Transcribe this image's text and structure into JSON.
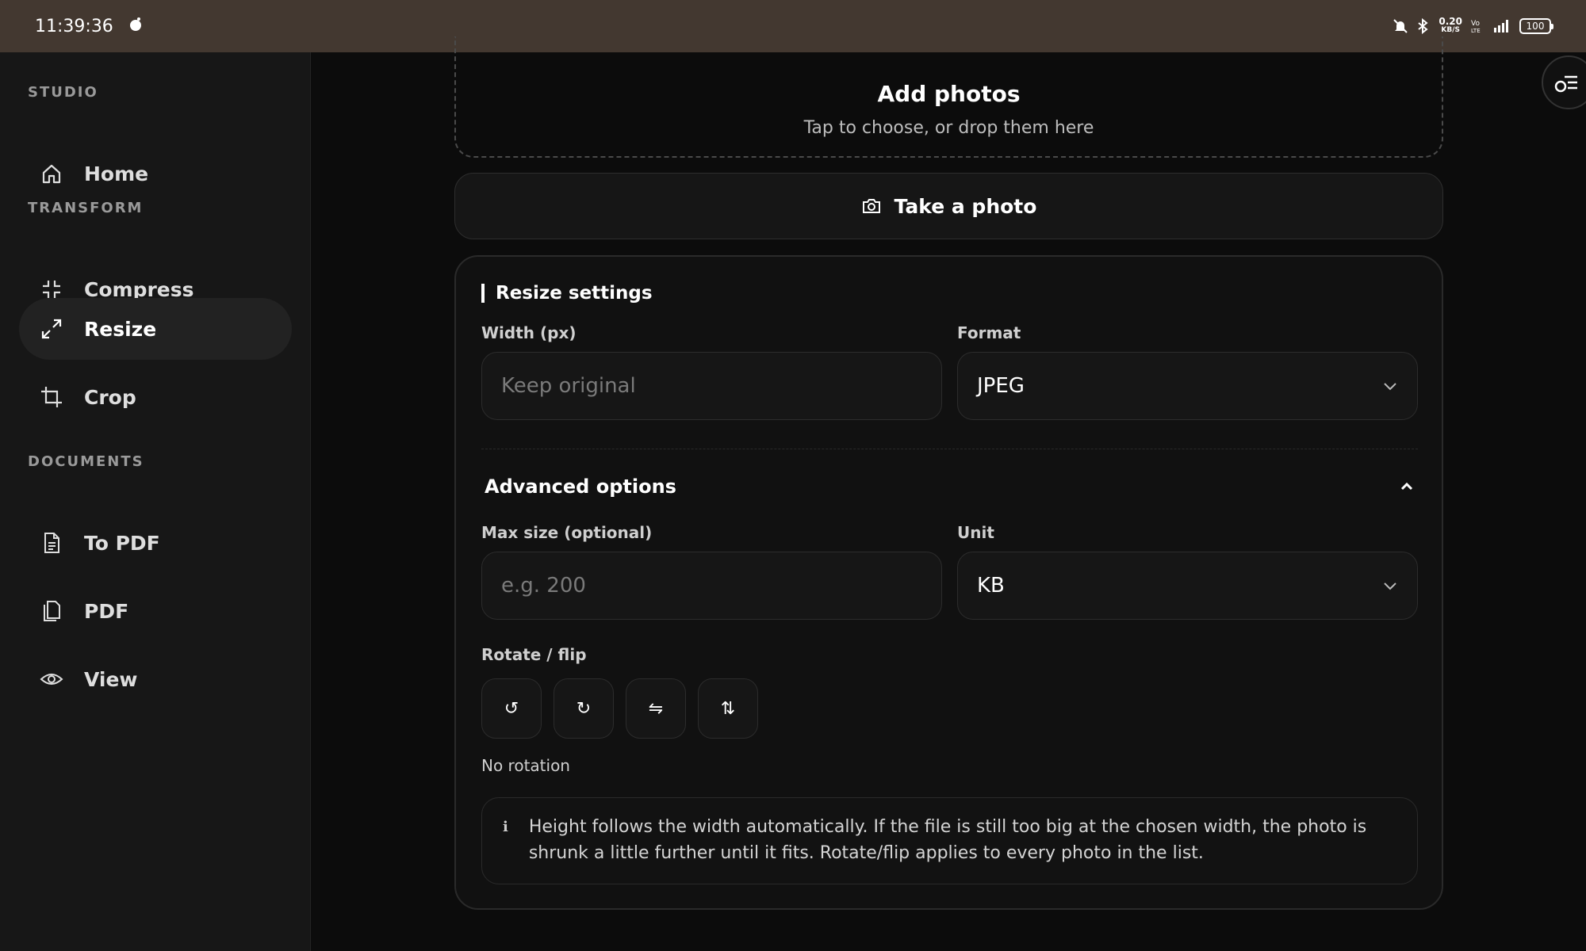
{
  "status_bar": {
    "time": "11:39:36",
    "net_speed_value": "0.20",
    "net_speed_unit": "KB/S",
    "battery": "100"
  },
  "sidebar": {
    "sections": {
      "studio": "STUDIO",
      "transform": "TRANSFORM",
      "documents": "DOCUMENTS"
    },
    "items": {
      "home": "Home",
      "compress": "Compress",
      "resize": "Resize",
      "crop": "Crop",
      "to_pdf": "To PDF",
      "pdf": "PDF",
      "view": "View"
    },
    "active": "Resize"
  },
  "upload": {
    "title": "Add photos",
    "subtitle": "Tap to choose, or drop them here",
    "take_photo": "Take a photo"
  },
  "settings": {
    "title": "Resize settings",
    "width_label": "Width (px)",
    "width_placeholder": "Keep original",
    "format_label": "Format",
    "format_value": "JPEG",
    "advanced_label": "Advanced options",
    "max_size_label": "Max size (optional)",
    "max_size_placeholder": "e.g. 200",
    "unit_label": "Unit",
    "unit_value": "KB",
    "rotate_label": "Rotate / flip",
    "rotation_status": "No rotation",
    "info_icon": "i",
    "info_text": "Height follows the width automatically. If the file is still too big at the chosen width, the photo is shrunk a little further until it fits. Rotate/flip applies to every photo in the list."
  },
  "icons": {
    "rotate_left": "↺",
    "rotate_right": "↻",
    "flip_horizontal": "⇋",
    "flip_vertical": "⇅"
  }
}
